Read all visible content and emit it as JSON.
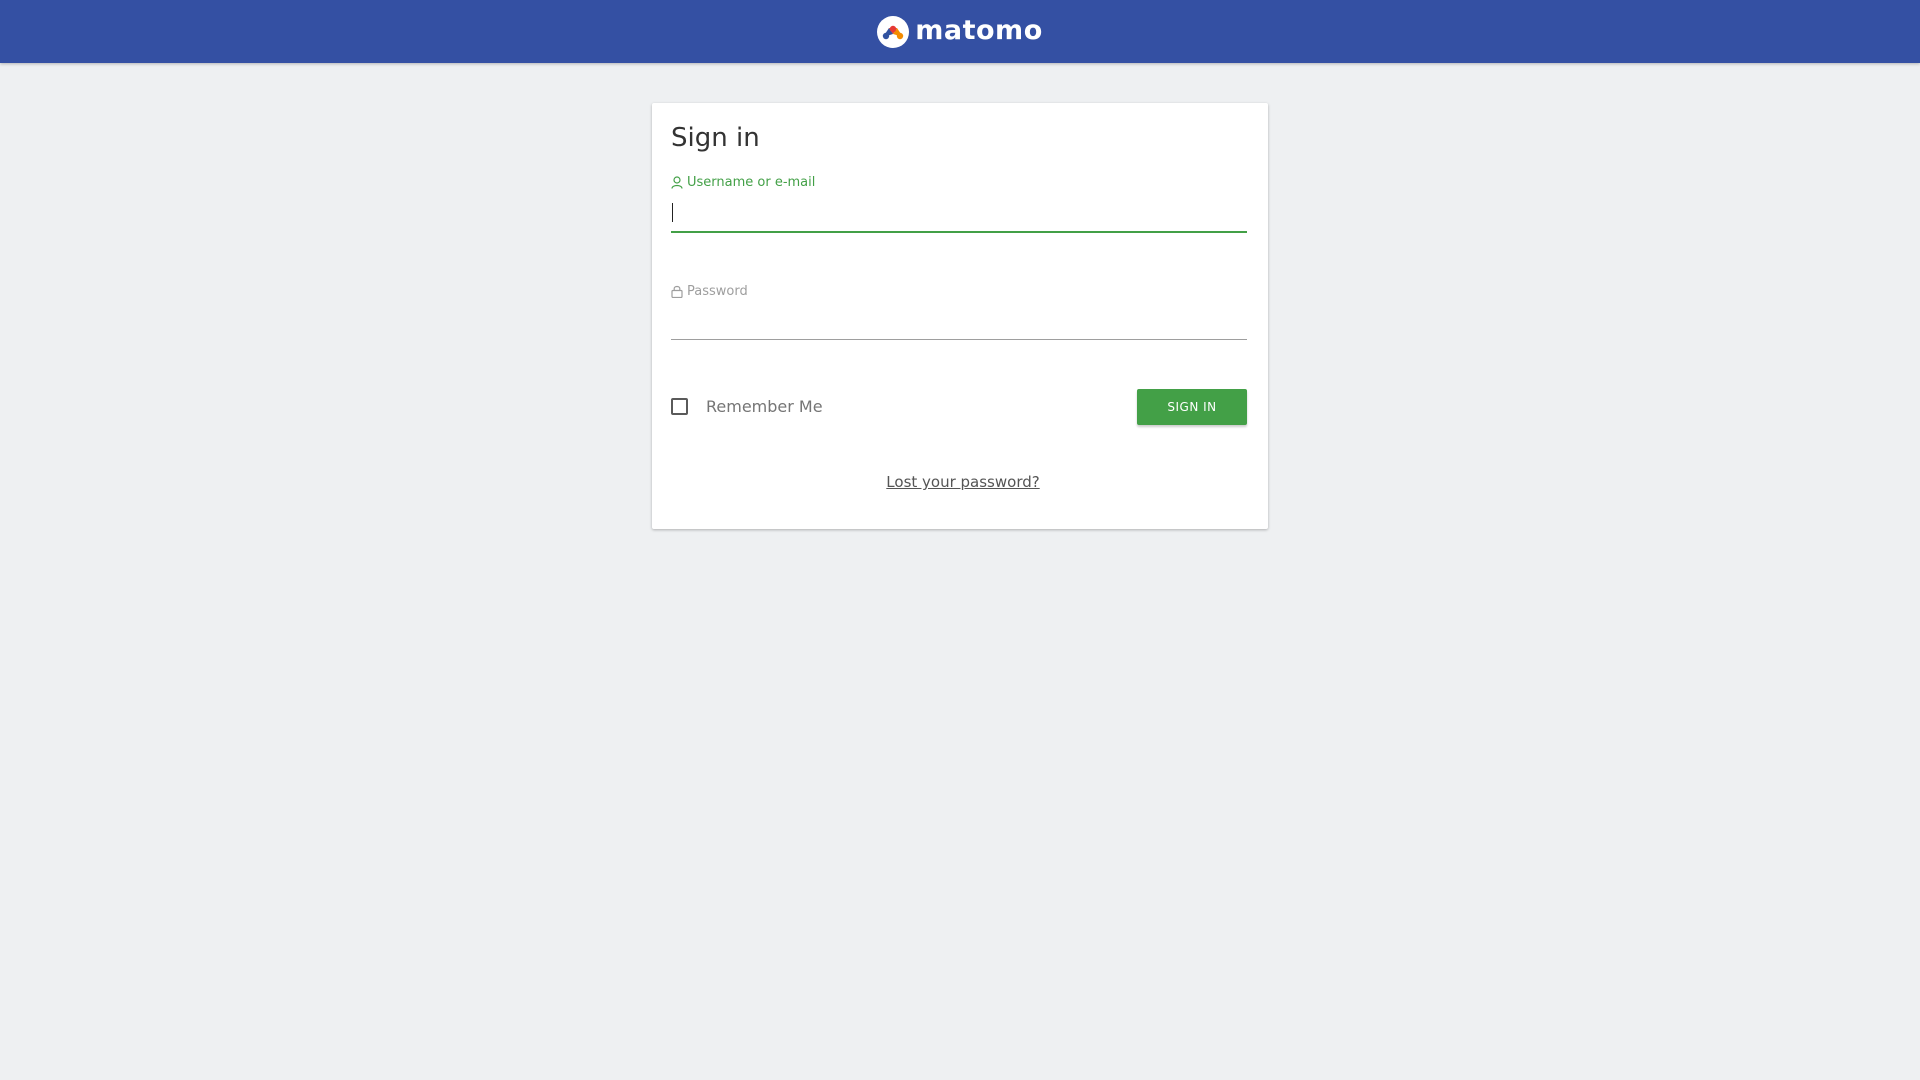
{
  "header": {
    "brand": "matomo",
    "bg_color": "#3450a3"
  },
  "login": {
    "title": "Sign in",
    "username_label": "Username or e-mail",
    "username_value": "",
    "password_label": "Password",
    "password_value": "",
    "remember_label": "Remember Me",
    "remember_checked": false,
    "signin_button": "SIGN IN",
    "lost_password": "Lost your password?"
  },
  "colors": {
    "accent": "#43a047",
    "background": "#eef0f2"
  },
  "icons": {
    "logo": "matomo-logo-icon",
    "username": "user-icon",
    "password": "lock-icon"
  }
}
